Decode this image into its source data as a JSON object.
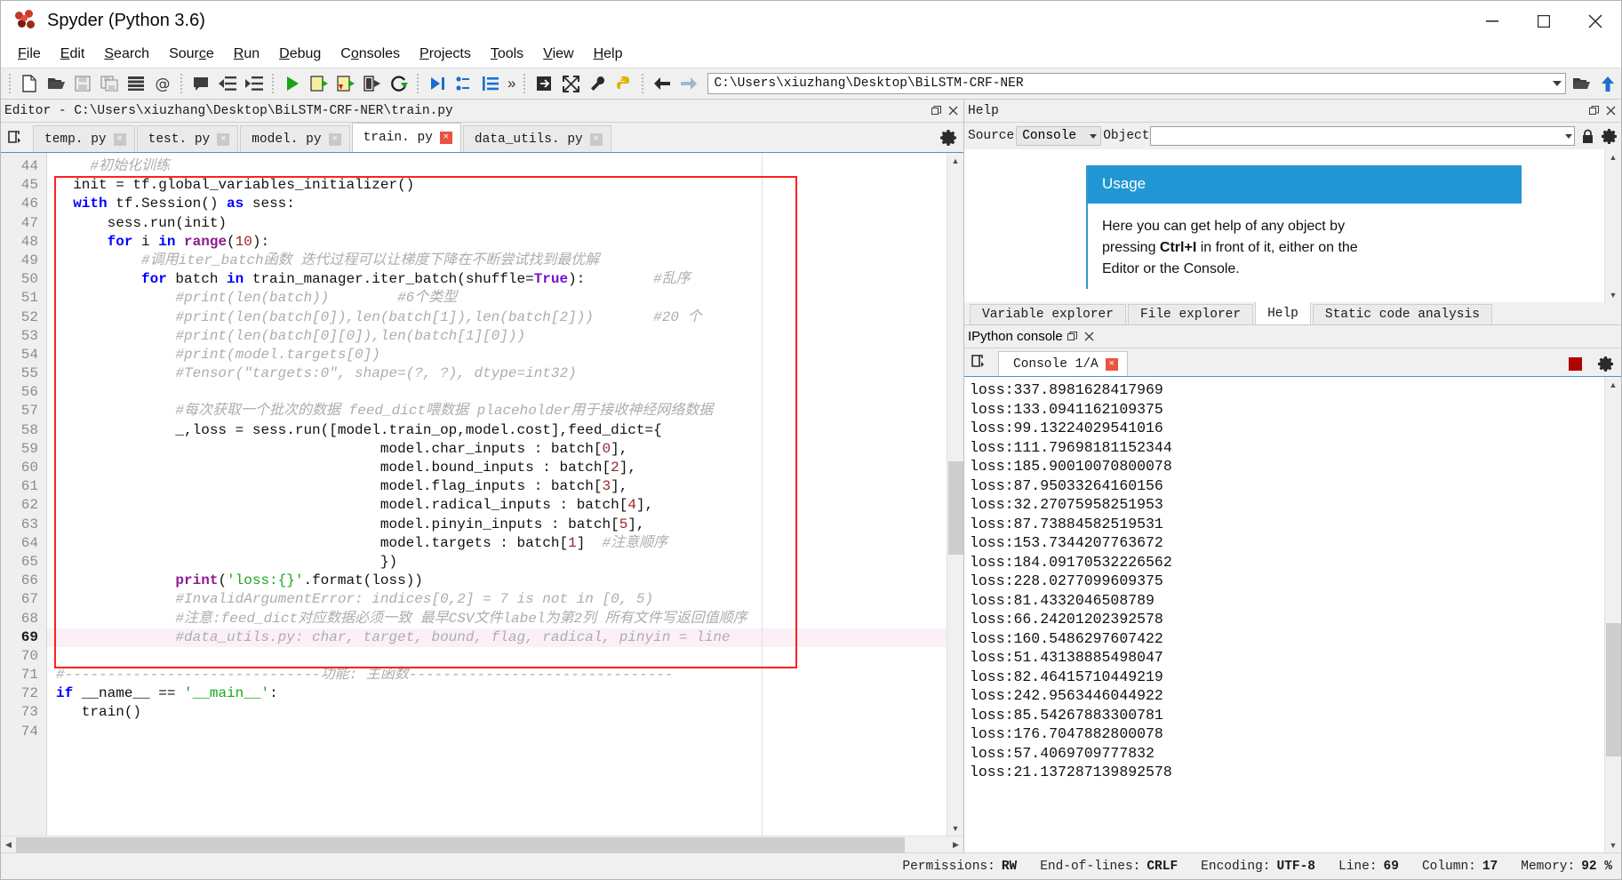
{
  "window": {
    "title": "Spyder (Python 3.6)",
    "minimize": "–",
    "maximize": "☐",
    "close": "✕"
  },
  "menu": [
    {
      "label": "File",
      "accel": "F"
    },
    {
      "label": "Edit",
      "accel": "E"
    },
    {
      "label": "Search",
      "accel": "S"
    },
    {
      "label": "Source",
      "accel": "c"
    },
    {
      "label": "Run",
      "accel": "R"
    },
    {
      "label": "Debug",
      "accel": "D"
    },
    {
      "label": "Consoles",
      "accel": "o"
    },
    {
      "label": "Projects",
      "accel": "P"
    },
    {
      "label": "Tools",
      "accel": "T"
    },
    {
      "label": "View",
      "accel": "V"
    },
    {
      "label": "Help",
      "accel": "H"
    }
  ],
  "toolbar": {
    "icons": [
      "new-file-icon",
      "open-file-icon",
      "save-file-icon",
      "save-all-icon",
      "file-list-icon",
      "at-icon",
      "comment-icon",
      "unindent-icon",
      "indent-icon",
      "run-icon",
      "run-cell-icon",
      "run-cell-advance-icon",
      "run-selection-icon",
      "re-run-icon",
      "debug-icon",
      "debug-step-icon",
      "debug-step-into-icon",
      "more-icon",
      "debug-exit-icon",
      "maximize-pane-icon",
      "preferences-icon",
      "python-path-icon",
      "back-icon",
      "forward-icon"
    ],
    "more_label": "»",
    "path_value": "C:\\Users\\xiuzhang\\Desktop\\BiLSTM-CRF-NER",
    "browse_icon": "open-folder-icon",
    "parent_icon": "up-arrow-icon"
  },
  "editor": {
    "pane_title": "Editor - C:\\Users\\xiuzhang\\Desktop\\BiLSTM-CRF-NER\\train.py",
    "undock_icon": "undock-icon",
    "close_icon": "close-icon",
    "browse_tabs_icon": "browse-tabs-icon",
    "options_icon": "gear-icon",
    "tabs": [
      {
        "label": "temp. py",
        "active": false
      },
      {
        "label": "test. py",
        "active": false
      },
      {
        "label": "model. py",
        "active": false
      },
      {
        "label": "train. py",
        "active": true
      },
      {
        "label": "data_utils. py",
        "active": false
      }
    ],
    "first_line": 44,
    "current_line": 69,
    "lines": [
      {
        "n": 44,
        "tokens": [
          {
            "t": "    ",
            "c": "op"
          },
          {
            "t": "#初始化训练",
            "c": "cm"
          }
        ]
      },
      {
        "n": 45,
        "tokens": [
          {
            "t": "  init ",
            "c": "op"
          },
          {
            "t": "= ",
            "c": "op"
          },
          {
            "t": "tf.global_variables_initializer()",
            "c": "op"
          }
        ]
      },
      {
        "n": 46,
        "tokens": [
          {
            "t": "  ",
            "c": "op"
          },
          {
            "t": "with ",
            "c": "kw"
          },
          {
            "t": "tf.Session() ",
            "c": "op"
          },
          {
            "t": "as ",
            "c": "kw"
          },
          {
            "t": "sess:",
            "c": "op"
          }
        ]
      },
      {
        "n": 47,
        "tokens": [
          {
            "t": "      sess.run(init)",
            "c": "op"
          }
        ]
      },
      {
        "n": 48,
        "tokens": [
          {
            "t": "      ",
            "c": "op"
          },
          {
            "t": "for ",
            "c": "kw"
          },
          {
            "t": "i ",
            "c": "op"
          },
          {
            "t": "in ",
            "c": "kw"
          },
          {
            "t": "range",
            "c": "bi"
          },
          {
            "t": "(",
            "c": "op"
          },
          {
            "t": "10",
            "c": "num"
          },
          {
            "t": "):",
            "c": "op"
          }
        ]
      },
      {
        "n": 49,
        "tokens": [
          {
            "t": "          ",
            "c": "op"
          },
          {
            "t": "#调用iter_batch函数 迭代过程可以让梯度下降在不断尝试找到最优解",
            "c": "cm"
          }
        ]
      },
      {
        "n": 50,
        "tokens": [
          {
            "t": "          ",
            "c": "op"
          },
          {
            "t": "for ",
            "c": "kw"
          },
          {
            "t": "batch ",
            "c": "op"
          },
          {
            "t": "in ",
            "c": "kw"
          },
          {
            "t": "train_manager.iter_batch(shuffle=",
            "c": "op"
          },
          {
            "t": "True",
            "c": "kw2"
          },
          {
            "t": "):",
            "c": "op"
          },
          {
            "t": "        #乱序",
            "c": "cm"
          }
        ]
      },
      {
        "n": 51,
        "tokens": [
          {
            "t": "              ",
            "c": "op"
          },
          {
            "t": "#print(len(batch))        #6个类型",
            "c": "cm"
          }
        ]
      },
      {
        "n": 52,
        "tokens": [
          {
            "t": "              ",
            "c": "op"
          },
          {
            "t": "#print(len(batch[0]),len(batch[1]),len(batch[2]))       #20 个",
            "c": "cm"
          }
        ]
      },
      {
        "n": 53,
        "tokens": [
          {
            "t": "              ",
            "c": "op"
          },
          {
            "t": "#print(len(batch[0][0]),len(batch[1][0]))",
            "c": "cm"
          }
        ]
      },
      {
        "n": 54,
        "tokens": [
          {
            "t": "              ",
            "c": "op"
          },
          {
            "t": "#print(model.targets[0])",
            "c": "cm"
          }
        ]
      },
      {
        "n": 55,
        "tokens": [
          {
            "t": "              ",
            "c": "op"
          },
          {
            "t": "#Tensor(\"targets:0\", shape=(?, ?), dtype=int32)",
            "c": "cm"
          }
        ]
      },
      {
        "n": 56,
        "tokens": [
          {
            "t": "",
            "c": "op"
          }
        ]
      },
      {
        "n": 57,
        "tokens": [
          {
            "t": "              ",
            "c": "op"
          },
          {
            "t": "#每次获取一个批次的数据 feed_dict喂数据 placeholder用于接收神经网络数据",
            "c": "cm"
          }
        ]
      },
      {
        "n": 58,
        "tokens": [
          {
            "t": "              _,loss = sess.run([model.train_op,model.cost],feed_dict={",
            "c": "op"
          }
        ]
      },
      {
        "n": 59,
        "tokens": [
          {
            "t": "                                      model.char_inputs : batch[",
            "c": "op"
          },
          {
            "t": "0",
            "c": "num"
          },
          {
            "t": "],",
            "c": "op"
          }
        ]
      },
      {
        "n": 60,
        "tokens": [
          {
            "t": "                                      model.bound_inputs : batch[",
            "c": "op"
          },
          {
            "t": "2",
            "c": "num"
          },
          {
            "t": "],",
            "c": "op"
          }
        ]
      },
      {
        "n": 61,
        "tokens": [
          {
            "t": "                                      model.flag_inputs : batch[",
            "c": "op"
          },
          {
            "t": "3",
            "c": "num"
          },
          {
            "t": "],",
            "c": "op"
          }
        ]
      },
      {
        "n": 62,
        "tokens": [
          {
            "t": "                                      model.radical_inputs : batch[",
            "c": "op"
          },
          {
            "t": "4",
            "c": "num"
          },
          {
            "t": "],",
            "c": "op"
          }
        ]
      },
      {
        "n": 63,
        "tokens": [
          {
            "t": "                                      model.pinyin_inputs : batch[",
            "c": "op"
          },
          {
            "t": "5",
            "c": "num"
          },
          {
            "t": "],",
            "c": "op"
          }
        ]
      },
      {
        "n": 64,
        "tokens": [
          {
            "t": "                                      model.targets : batch[",
            "c": "op"
          },
          {
            "t": "1",
            "c": "num"
          },
          {
            "t": "] ",
            "c": "op"
          },
          {
            "t": " #注意顺序",
            "c": "cm"
          }
        ]
      },
      {
        "n": 65,
        "tokens": [
          {
            "t": "                                      })",
            "c": "op"
          }
        ]
      },
      {
        "n": 66,
        "tokens": [
          {
            "t": "              ",
            "c": "op"
          },
          {
            "t": "print",
            "c": "bi"
          },
          {
            "t": "(",
            "c": "op"
          },
          {
            "t": "'loss:{}'",
            "c": "str"
          },
          {
            "t": ".format(loss))",
            "c": "op"
          }
        ]
      },
      {
        "n": 67,
        "tokens": [
          {
            "t": "              ",
            "c": "op"
          },
          {
            "t": "#InvalidArgumentError: indices[0,2] = 7 is not in [0, 5)",
            "c": "cm"
          }
        ]
      },
      {
        "n": 68,
        "tokens": [
          {
            "t": "              ",
            "c": "op"
          },
          {
            "t": "#注意:feed_dict对应数据必须一致 最早CSV文件label为第2列 所有文件写返回值顺序",
            "c": "cm"
          }
        ]
      },
      {
        "n": 69,
        "tokens": [
          {
            "t": "              ",
            "c": "op"
          },
          {
            "t": "#data_utils.py: char, target, bound, flag, radical, pinyin = line",
            "c": "cm"
          }
        ]
      },
      {
        "n": 70,
        "tokens": [
          {
            "t": "",
            "c": "op"
          }
        ]
      },
      {
        "n": 71,
        "tokens": [
          {
            "t": "#------------------------------功能: 主函数-------------------------------",
            "c": "cm"
          }
        ]
      },
      {
        "n": 72,
        "tokens": [
          {
            "t": "",
            "c": "op"
          },
          {
            "t": "if ",
            "c": "kw"
          },
          {
            "t": "__name__ ",
            "c": "op"
          },
          {
            "t": "== ",
            "c": "op"
          },
          {
            "t": "'__main__'",
            "c": "str"
          },
          {
            "t": ":",
            "c": "op"
          }
        ]
      },
      {
        "n": 73,
        "tokens": [
          {
            "t": "   train()",
            "c": "op"
          }
        ]
      },
      {
        "n": 74,
        "tokens": [
          {
            "t": "",
            "c": "op"
          }
        ]
      }
    ]
  },
  "help": {
    "pane_title": "Help",
    "undock_icon": "undock-icon",
    "close_icon": "close-icon",
    "source_label": "Source",
    "source_value": "Console",
    "object_label": "Object",
    "object_value": "",
    "lock_icon": "lock-icon",
    "options_icon": "gear-icon",
    "usage_title": "Usage",
    "usage_text_1": "Here you can get help of any object by",
    "usage_text_2_pre": "pressing ",
    "usage_text_2_bold": "Ctrl+I",
    "usage_text_2_post": " in front of it, either on the",
    "usage_text_3": "Editor or the Console.",
    "tabs": [
      {
        "label": "Variable explorer",
        "active": false
      },
      {
        "label": "File explorer",
        "active": false
      },
      {
        "label": "Help",
        "active": true
      },
      {
        "label": "Static code analysis",
        "active": false
      }
    ]
  },
  "console": {
    "pane_title": "IPython console",
    "undock_icon": "undock-icon",
    "close_icon": "close-icon",
    "browse_tabs_icon": "browse-tabs-icon",
    "tab_label": "Console 1/A",
    "tab_close_icon": "close-icon",
    "stop_icon": "stop-button",
    "options_icon": "gear-icon",
    "output": "loss:337.8981628417969\nloss:133.0941162109375\nloss:99.13224029541016\nloss:111.79698181152344\nloss:185.90010070800078\nloss:87.95033264160156\nloss:32.27075958251953\nloss:87.73884582519531\nloss:153.7344207763672\nloss:184.09170532226562\nloss:228.0277099609375\nloss:81.4332046508789\nloss:66.24201202392578\nloss:160.5486297607422\nloss:51.43138885498047\nloss:82.46415710449219\nloss:242.9563446044922\nloss:85.54267883300781\nloss:176.7047882800078\nloss:57.4069709777832\nloss:21.137287139892578"
  },
  "statusbar": {
    "permissions_label": "Permissions:",
    "permissions_value": "RW",
    "eol_label": "End-of-lines:",
    "eol_value": "CRLF",
    "encoding_label": "Encoding:",
    "encoding_value": "UTF-8",
    "line_label": "Line:",
    "line_value": "69",
    "column_label": "Column:",
    "column_value": "17",
    "memory_label": "Memory:",
    "memory_value": "92 %"
  },
  "colors": {
    "accent": "#2196d4",
    "selection_box": "#ff2020",
    "tab_close": "#e8543f",
    "stop": "#b00000"
  }
}
